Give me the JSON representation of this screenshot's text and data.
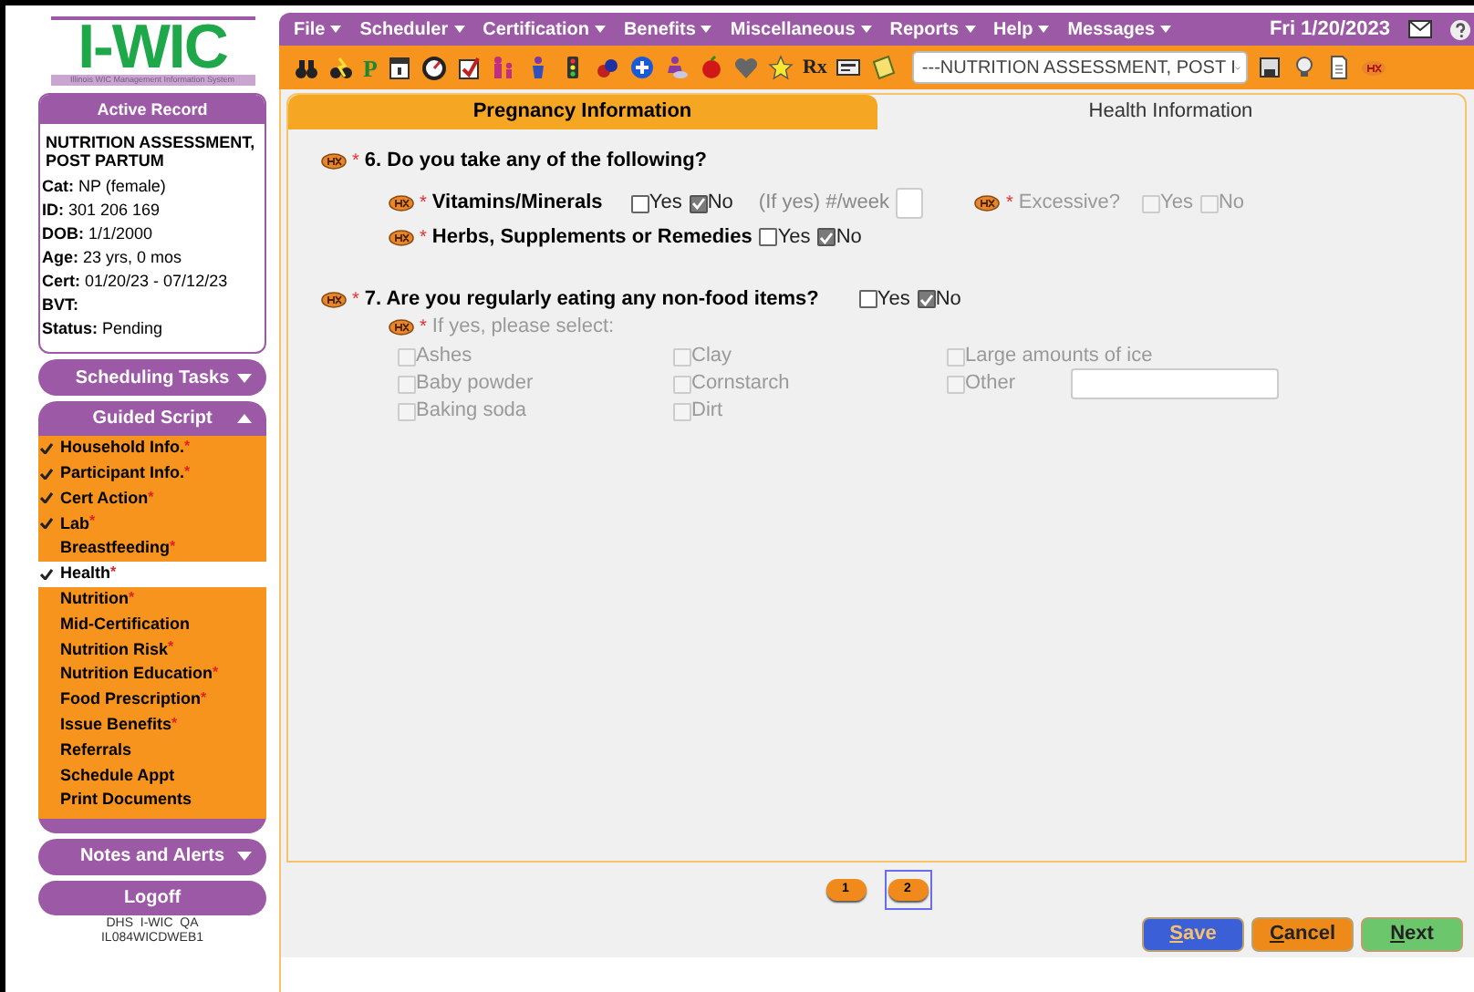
{
  "logo": {
    "title": "I-WIC",
    "subtitle": "Illinois WIC Management Information System"
  },
  "menu": [
    {
      "label": "File"
    },
    {
      "label": "Scheduler"
    },
    {
      "label": "Certification"
    },
    {
      "label": "Benefits"
    },
    {
      "label": "Miscellaneous"
    },
    {
      "label": "Reports"
    },
    {
      "label": "Help"
    },
    {
      "label": "Messages"
    }
  ],
  "date": "Fri 1/20/2023",
  "required_mark": "*",
  "toolbar": {
    "letters": [
      "P",
      "Rx"
    ],
    "record_select": "---NUTRITION ASSESSMENT, POST I"
  },
  "active_record": {
    "title": "Active Record",
    "name": "NUTRITION ASSESSMENT, POST PARTUM",
    "fields": [
      {
        "label": "Cat:",
        "value": "NP (female)"
      },
      {
        "label": "ID:",
        "value": "301 206 169"
      },
      {
        "label": "DOB:",
        "value": "1/1/2000"
      },
      {
        "label": "Age:",
        "value": "23 yrs, 0 mos"
      },
      {
        "label": "Cert:",
        "value": "01/20/23 - 07/12/23"
      },
      {
        "label": "BVT:"
      },
      {
        "label": "Status:",
        "value": "Pending"
      }
    ]
  },
  "scheduling_tasks": {
    "label": "Scheduling Tasks",
    "expanded": false
  },
  "guided_script": {
    "label": "Guided Script",
    "expanded": true,
    "items": [
      {
        "label": "Household Info.",
        "checked": true,
        "required": true,
        "selected": false
      },
      {
        "label": "Participant Info.",
        "checked": true,
        "required": true,
        "selected": false
      },
      {
        "label": "Cert Action",
        "checked": true,
        "required": true,
        "selected": false
      },
      {
        "label": "Lab",
        "checked": true,
        "required": true,
        "selected": false
      },
      {
        "label": "Breastfeeding",
        "checked": false,
        "required": true,
        "selected": false
      },
      {
        "label": "Health",
        "checked": true,
        "required": true,
        "selected": true
      },
      {
        "label": "Nutrition",
        "checked": false,
        "required": true,
        "selected": false
      },
      {
        "label": "Mid-Certification",
        "checked": false,
        "required": false,
        "selected": false
      },
      {
        "label": "Nutrition Risk",
        "checked": false,
        "required": true,
        "selected": false
      },
      {
        "label": "Nutrition Education",
        "checked": false,
        "required": true,
        "selected": false
      },
      {
        "label": "Food Prescription",
        "checked": false,
        "required": true,
        "selected": false
      },
      {
        "label": "Issue Benefits",
        "checked": false,
        "required": true,
        "selected": false
      },
      {
        "label": "Referrals",
        "checked": false,
        "required": false,
        "selected": false
      },
      {
        "label": "Schedule Appt",
        "checked": false,
        "required": false,
        "selected": false
      },
      {
        "label": "Print Documents",
        "checked": false,
        "required": false,
        "selected": false
      }
    ]
  },
  "notes_and_alerts": {
    "label": "Notes and Alerts",
    "expanded": false
  },
  "logoff": "Logoff",
  "server": [
    "DHS  I-WIC  QA",
    "IL084WICDWEB1"
  ],
  "tabs": [
    {
      "label": "Pregnancy Information",
      "selected": false
    },
    {
      "label": "Health Information",
      "selected": true
    }
  ],
  "question_6": {
    "text": "6. Do you take any of the following?",
    "required": true,
    "vitamins": {
      "label": "Vitamins/Minerals",
      "required": true,
      "yes": {
        "label": "Yes",
        "checked": false
      },
      "no": {
        "label": "No",
        "checked": true
      },
      "per_week_label": "(If yes) #/week",
      "excessive": {
        "label": "Excessive?",
        "required": true,
        "disabled": true,
        "yes": {
          "label": "Yes",
          "checked": false
        },
        "no": {
          "label": "No",
          "checked": false
        }
      }
    },
    "herbs": {
      "label": "Herbs, Supplements or Remedies",
      "required": true,
      "yes": {
        "label": "Yes",
        "checked": false
      },
      "no": {
        "label": "No",
        "checked": true
      }
    }
  },
  "question_7": {
    "text": "7. Are you regularly eating any non-food items?",
    "required": true,
    "yes": {
      "label": "Yes",
      "checked": false
    },
    "no": {
      "label": "No",
      "checked": true
    },
    "select_label": "If yes, please select:",
    "disabled": true,
    "options": [
      {
        "label": "Ashes",
        "checked": false
      },
      {
        "label": "Clay",
        "checked": false
      },
      {
        "label": "Large amounts of ice",
        "checked": false
      },
      {
        "label": "Baby powder",
        "checked": false
      },
      {
        "label": "Cornstarch",
        "checked": false
      },
      {
        "label": "Other",
        "checked": false,
        "kind": "other"
      },
      {
        "label": "Baking soda",
        "checked": false
      },
      {
        "label": "Dirt",
        "checked": false
      }
    ]
  },
  "pages": [
    {
      "label": "1",
      "selected": false
    },
    {
      "label": "2",
      "selected": true
    }
  ],
  "buttons": [
    {
      "label": "Save",
      "kind": "save"
    },
    {
      "label": "Cancel",
      "kind": "cancel"
    },
    {
      "label": "Next",
      "kind": "next"
    }
  ]
}
